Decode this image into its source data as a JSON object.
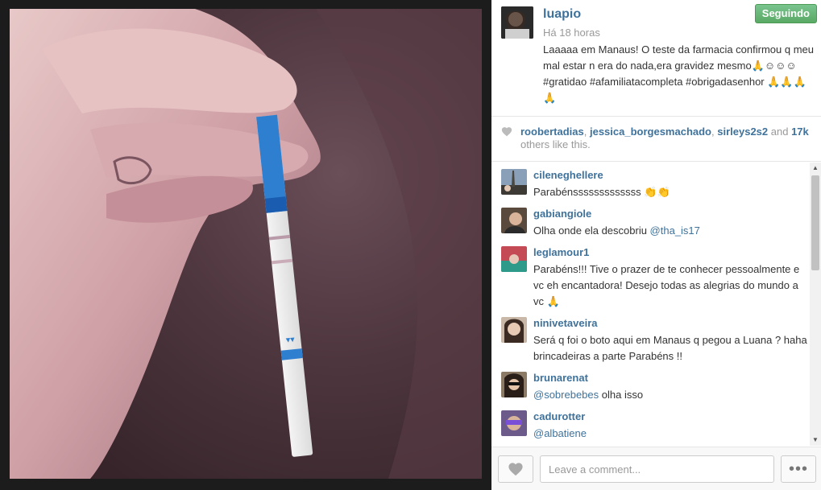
{
  "post": {
    "owner": "luapio",
    "time_ago": "Há 18 horas",
    "follow_label": "Seguindo",
    "caption": "Laaaaa em Manaus! O teste da farmacia confirmou q meu mal estar n era do nada,era gravidez mesmo🙏☺☺☺ #gratidao #afamiliatacompleta #obrigadasenhor 🙏🙏🙏🙏"
  },
  "likes": {
    "user1": "roobertadias",
    "sep1": ", ",
    "user2": "jessica_borgesmachado",
    "sep2": ", ",
    "user3": "sirleys2s2",
    "and": " and ",
    "count": "17k",
    "others": " others like this."
  },
  "comments": [
    {
      "user": "cileneghellere",
      "text": "Parabénsssssssssssss 👏👏"
    },
    {
      "user": "gabiangiole",
      "text": "Olha onde ela descobriu ",
      "mention": "@tha_is17"
    },
    {
      "user": "leglamour1",
      "text": "Parabéns!!! Tive o prazer de te conhecer pessoalmente e vc eh encantadora! Desejo todas as alegrias do mundo a vc 🙏"
    },
    {
      "user": "ninivetaveira",
      "text": "Será q foi o boto aqui em Manaus q pegou a Luana ? haha brincadeiras a parte Parabéns !!"
    },
    {
      "user": "brunarenat",
      "mention": "@sobrebebes",
      "text": " olha isso"
    },
    {
      "user": "cadurotter",
      "mention": "@albatiene",
      "text": ""
    }
  ],
  "footer": {
    "comment_placeholder": "Leave a comment...",
    "more_label": "•••"
  },
  "icons": {
    "like": "heart-icon",
    "more": "ellipsis-icon"
  },
  "colors": {
    "link": "#3f729b",
    "follow_green": "#5aa964"
  }
}
